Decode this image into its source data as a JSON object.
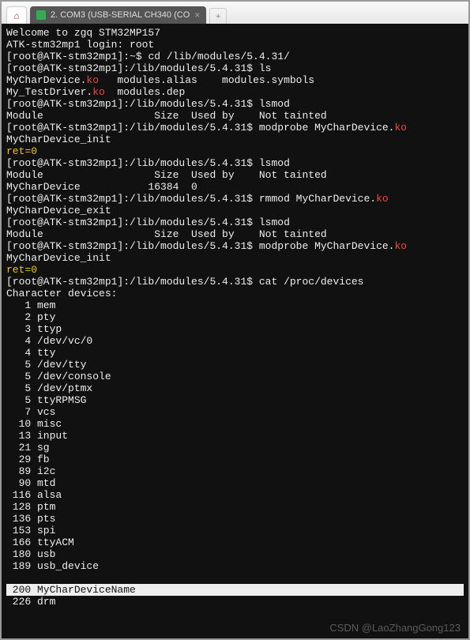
{
  "tab": {
    "title": "2. COM3 (USB-SERIAL CH340 (CO",
    "close_glyph": "×",
    "new_glyph": "+",
    "home_glyph": "⌂"
  },
  "watermark": "CSDN @LaoZhangGong123",
  "t": {
    "welcome": "Welcome to zgq STM32MP157",
    "login": "ATK-stm32mp1 login: ",
    "root": "root",
    "p_home": "[root@ATK-stm32mp1]:~$ ",
    "cmd_cd": "cd /lib/modules/5.4.31/",
    "p_mod": "[root@ATK-stm32mp1]:/lib/modules/5.4.31$ ",
    "cmd_ls": "ls",
    "ls_row1_a": "MyCharDevice.",
    "ls_row1_ko": "ko",
    "ls_row1_b": "   modules.alias    modules.symbols",
    "ls_row2_a": "My_TestDriver.",
    "ls_row2_ko": "ko",
    "ls_row2_b": "  modules.dep",
    "cmd_lsmod": "lsmod",
    "lsmod_hdr": "Module                  Size  Used by    Not tainted",
    "cmd_modprobe": "modprobe MyCharDevice.",
    "ko": "ko",
    "init": "MyCharDevice_init",
    "ret0": "ret=0",
    "lsmod_row": "MyCharDevice           16384  0",
    "cmd_rmmod": "rmmod MyCharDevice.",
    "exit": "MyCharDevice_exit",
    "cmd_cat": "cat /proc/devices",
    "chardev": "Character devices:",
    "devs": [
      "   1 mem",
      "   2 pty",
      "   3 ttyp",
      "   4 /dev/vc/0",
      "   4 tty",
      "   5 /dev/tty",
      "   5 /dev/console",
      "   5 /dev/ptmx",
      "   5 ttyRPMSG",
      "   7 vcs",
      "  10 misc",
      "  13 input",
      "  21 sg",
      "  29 fb",
      "  89 i2c",
      "  90 mtd",
      " 116 alsa",
      " 128 ptm",
      " 136 pts",
      " 153 spi",
      " 166 ttyACM",
      " 180 usb",
      " 189 usb_device"
    ],
    "dev_hl": " 200 MyCharDeviceName",
    "dev_last": " 226 drm"
  }
}
